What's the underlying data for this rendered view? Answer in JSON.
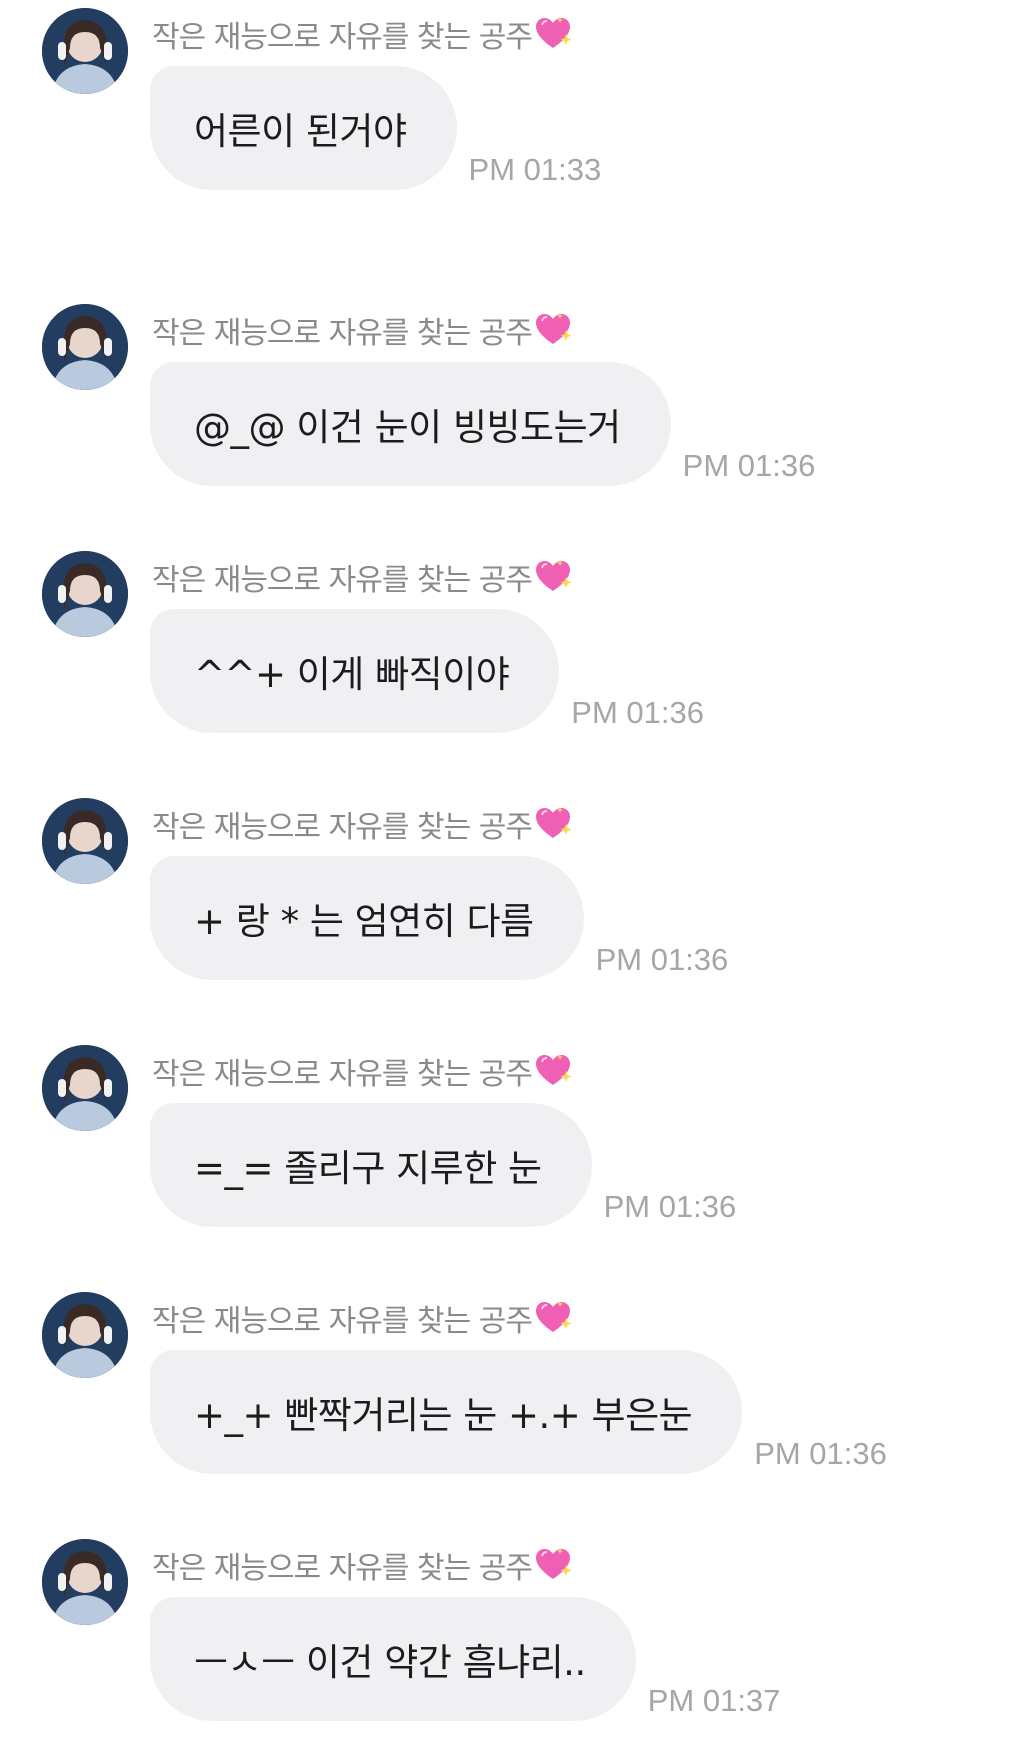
{
  "sender": {
    "name": "작은 재능으로 자유를 찾는 공주",
    "emoji_icon": "sparkling-heart-icon"
  },
  "colors": {
    "bubble": "#f0f0f2",
    "timestamp": "#a5a5aa",
    "sender_name": "#8a8a8e"
  },
  "messages": [
    {
      "text": "어른이 된거야",
      "time": "PM 01:33"
    },
    {
      "text": "@_@ 이건 눈이 빙빙도는거",
      "time": "PM 01:36"
    },
    {
      "text": "^^+ 이게 빠직이야",
      "time": "PM 01:36"
    },
    {
      "text": "+ 랑 * 는 엄연히 다름",
      "time": "PM 01:36"
    },
    {
      "text": "=_= 졸리구 지루한 눈",
      "time": "PM 01:36"
    },
    {
      "text": "+_+ 빤짝거리는 눈 +.+ 부은눈",
      "time": "PM 01:36"
    },
    {
      "text": "ㅡㅅㅡ 이건 약간 흠냐리..",
      "time": "PM 01:37"
    }
  ]
}
